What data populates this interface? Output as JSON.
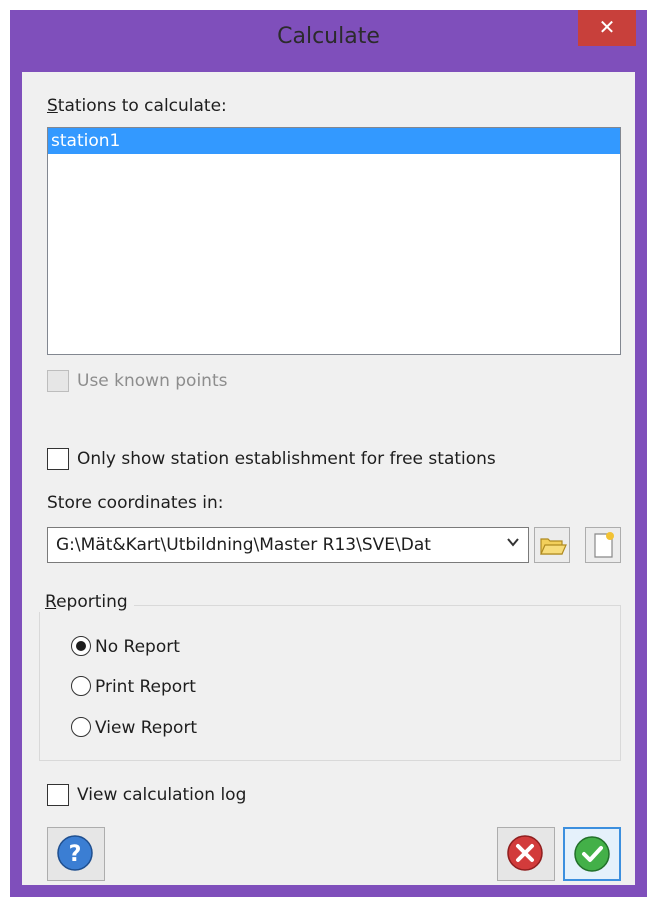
{
  "window": {
    "title": "Calculate",
    "close_label": "✕"
  },
  "stations": {
    "label": "Stations to calculate:",
    "items": [
      "station1"
    ]
  },
  "use_known_points": {
    "label": "Use known points",
    "checked": false,
    "enabled": false
  },
  "only_free_stations": {
    "label": "Only show station establishment for free stations",
    "checked": false
  },
  "store": {
    "label": "Store coordinates in:",
    "value": "G:\\Mät&Kart\\Utbildning\\Master R13\\SVE\\Dat"
  },
  "reporting": {
    "title": "Reporting",
    "options": [
      "No Report",
      "Print Report",
      "View Report"
    ],
    "selected": "No Report"
  },
  "view_log": {
    "label": "View calculation log",
    "checked": false
  },
  "icons": {
    "help": "help-icon",
    "cancel": "cancel-icon",
    "ok": "ok-icon",
    "browse": "folder-icon",
    "new_file": "new-file-icon"
  },
  "colors": {
    "title_bar": "#7f4fbb",
    "close": "#c8403b",
    "selection": "#3399ff"
  }
}
